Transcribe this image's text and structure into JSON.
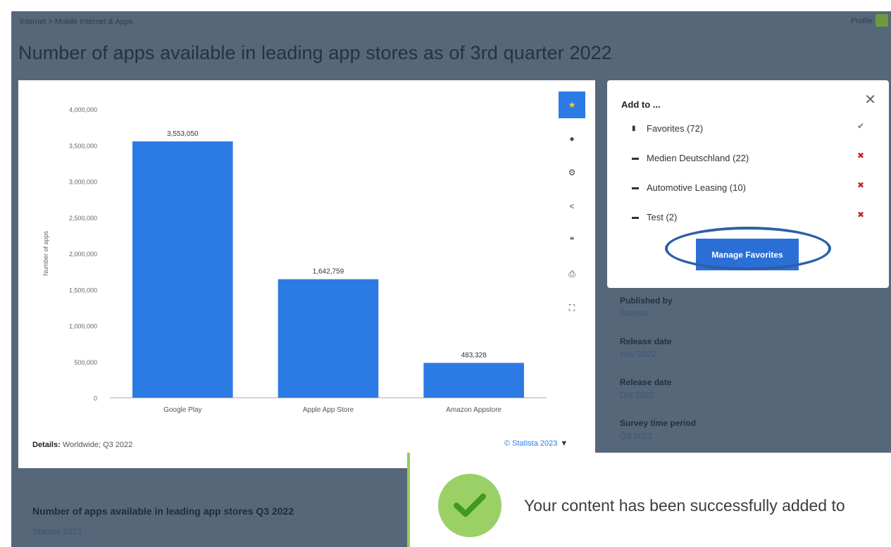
{
  "breadcrumb": "Internet > Mobile Internet & Apps",
  "user": {
    "name": "Profile"
  },
  "page_title": "Number of apps available in leading app stores as of 3rd quarter 2022",
  "toolbar": {
    "items": [
      {
        "name": "star-icon",
        "glyph": "★",
        "active": true
      },
      {
        "name": "bell-icon",
        "glyph": "●",
        "active": false
      },
      {
        "name": "gear-icon",
        "glyph": "⚙",
        "active": false
      },
      {
        "name": "share-icon",
        "glyph": "<",
        "active": false
      },
      {
        "name": "quote-icon",
        "glyph": "❝",
        "active": false
      },
      {
        "name": "print-icon",
        "glyph": "⎙",
        "active": false
      },
      {
        "name": "fullscreen-icon",
        "glyph": "⛶",
        "active": false
      }
    ]
  },
  "chart_data": {
    "type": "bar",
    "categories": [
      "Google Play",
      "Apple App Store",
      "Amazon Appstore"
    ],
    "values": [
      3553050,
      1642759,
      483328
    ],
    "value_labels": [
      "3,553,050",
      "1,642,759",
      "483,328"
    ],
    "ylabel": "Number of apps",
    "ylim": [
      0,
      4000000
    ],
    "yticks": [
      "0",
      "500,000",
      "1,000,000",
      "1,500,000",
      "2,000,000",
      "2,500,000",
      "3,000,000",
      "3,500,000",
      "4,000,000"
    ],
    "bar_color": "#2c7be5",
    "grid": false
  },
  "details": {
    "label": "Details:",
    "value": "Worldwide; Q3 2022"
  },
  "copyright": {
    "text": "© Statista 2023",
    "caret": "▼"
  },
  "popup": {
    "title": "Add to ...",
    "close": "✕",
    "items": [
      {
        "icon": "bookmark",
        "label": "Favorites (72)",
        "status": "✔",
        "status_type": "ok"
      },
      {
        "icon": "folder",
        "label": "Medien Deutschland (22)",
        "status": "✖",
        "status_type": "x"
      },
      {
        "icon": "folder",
        "label": "Automotive Leasing (10)",
        "status": "✖",
        "status_type": "x"
      },
      {
        "icon": "folder",
        "label": "Test (2)",
        "status": "✖",
        "status_type": "x"
      }
    ],
    "manage_label": "Manage Favorites"
  },
  "meta": [
    {
      "label": "Published by",
      "value": "Statista"
    },
    {
      "label": "Release date",
      "value": "Nov 2022"
    },
    {
      "label": "Release date",
      "value": "Oct 2022"
    },
    {
      "label": "Survey time period",
      "value": "Q3 2022"
    }
  ],
  "footer": {
    "title": "Number of apps available in leading app stores Q3 2022",
    "subtitle": "Statista 2023"
  },
  "toast": {
    "message": "Your content has been successfully added to"
  },
  "colors": {
    "accent": "#2c7be5",
    "overlay": "#56677a",
    "success": "#9ad065",
    "danger": "#c62828"
  }
}
